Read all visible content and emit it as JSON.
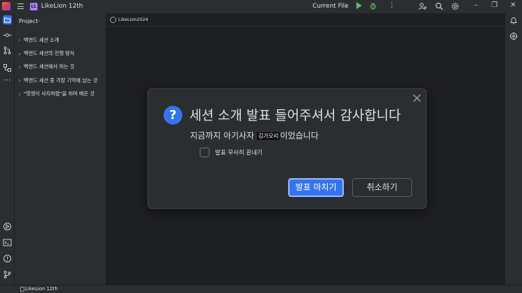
{
  "titlebar": {
    "project_badge": "LL",
    "project_name": "LikeLion 12th",
    "run_config": "Current File",
    "more_glyph": "⋮"
  },
  "project_panel": {
    "header": "Project",
    "items": [
      {
        "label": "백엔드 세션 소개"
      },
      {
        "label": "백엔드 세션의 진행 방식"
      },
      {
        "label": "백엔드 세션에서 하는 것"
      },
      {
        "label": "백엔드 세션 중 가장 기억에 남는 것"
      },
      {
        "label": "\"멋쟁이 사자처럼\"을 하며 배운 것"
      }
    ]
  },
  "editor": {
    "tab_label": "LikeLion2024"
  },
  "statusbar": {
    "text": "LikeLion 12th"
  },
  "dialog": {
    "icon_glyph": "?",
    "title": "세션 소개 발표 들어주셔서 감사합니다",
    "message_before": "지금까지 아기사자 ",
    "message_highlight": "김가오리",
    "message_after": "이었습니다",
    "checkbox_label": "발표 무사히 끝내기",
    "checkbox_checked": false,
    "primary_button": "발표 마치기",
    "secondary_button": "취소하기"
  },
  "colors": {
    "accent": "#3574f0",
    "run": "#5fb865",
    "badge": "#a97bff"
  }
}
